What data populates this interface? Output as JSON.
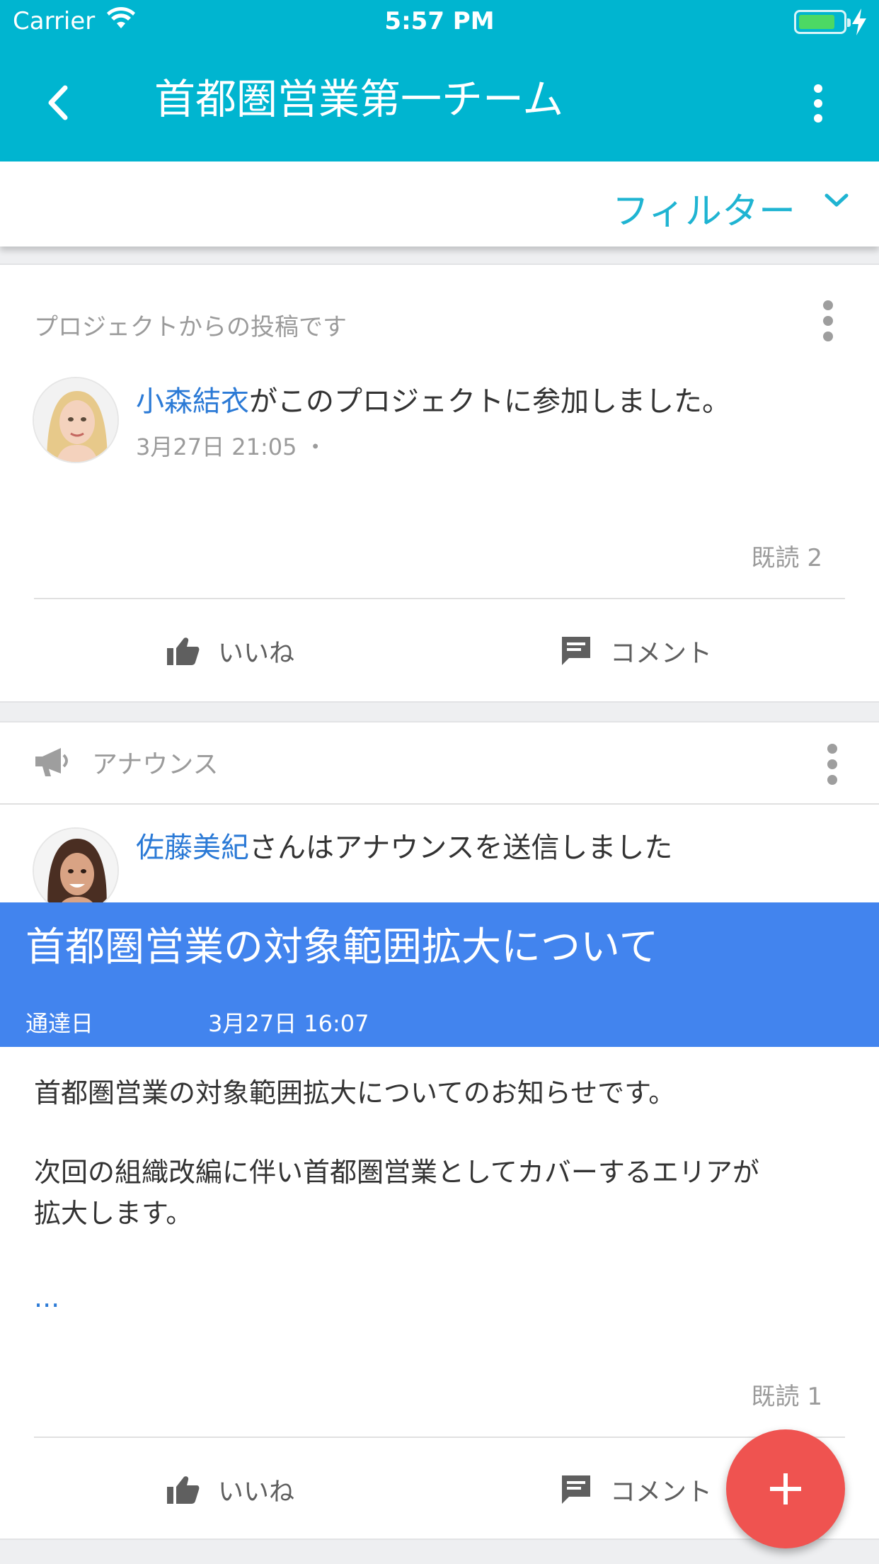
{
  "status_bar": {
    "carrier": "Carrier",
    "time": "5:57 PM"
  },
  "header": {
    "title": "首都圏営業第一チーム"
  },
  "filter": {
    "label": "フィルター"
  },
  "posts": [
    {
      "source": "プロジェクトからの投稿です",
      "actor_name": "小森結衣",
      "message": "がこのプロジェクトに参加しました。",
      "timestamp": "3月27日 21:05 ・",
      "read_count": "既読 2",
      "like_label": "いいね",
      "comment_label": "コメント"
    },
    {
      "type_label": "アナウンス",
      "actor_name": "佐藤美紀",
      "message": "さんはアナウンスを送信しました",
      "banner_title": "首都圏営業の対象範囲拡大について",
      "delivery_label": "通達日",
      "delivery_date": "3月27日 16:07",
      "body_line1": "首都圏営業の対象範囲拡大についてのお知らせです。",
      "body_line2": "次回の組織改編に伴い首都圏営業としてカバーするエリアが",
      "body_line3": "拡大します。",
      "more": "...",
      "read_count": "既読 1",
      "like_label": "いいね",
      "comment_label": "コメント"
    }
  ],
  "colors": {
    "header": "#00b5d0",
    "banner": "#4284ee",
    "fab": "#ef5350",
    "link": "#2b7ad6"
  }
}
